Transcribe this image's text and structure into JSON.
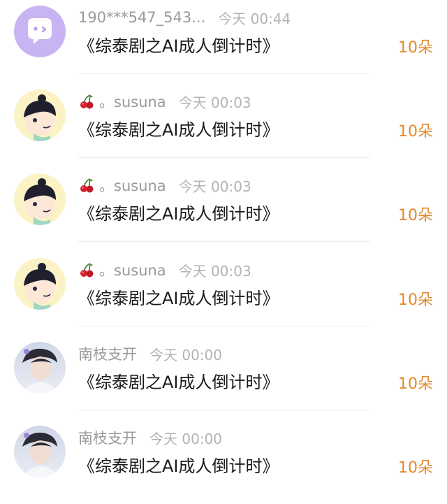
{
  "comments": [
    {
      "avatar": "speech-bubble-avatar",
      "prefix_icon": "",
      "username": "190***547_543...",
      "time": "今天 00:44",
      "title": "《综泰剧之AI成人倒计时》",
      "gift": "10朵"
    },
    {
      "avatar": "cartoon-boy-avatar",
      "prefix_icon": "cherry-icon",
      "username": "。susuna",
      "time": "今天 00:03",
      "title": "《综泰剧之AI成人倒计时》",
      "gift": "10朵"
    },
    {
      "avatar": "cartoon-boy-avatar",
      "prefix_icon": "cherry-icon",
      "username": "。susuna",
      "time": "今天 00:03",
      "title": "《综泰剧之AI成人倒计时》",
      "gift": "10朵"
    },
    {
      "avatar": "cartoon-boy-avatar",
      "prefix_icon": "cherry-icon",
      "username": "。susuna",
      "time": "今天 00:03",
      "title": "《综泰剧之AI成人倒计时》",
      "gift": "10朵"
    },
    {
      "avatar": "photo-person-avatar",
      "prefix_icon": "",
      "username": "南枝支开",
      "time": "今天 00:00",
      "title": "《综泰剧之AI成人倒计时》",
      "gift": "10朵"
    },
    {
      "avatar": "photo-person-avatar",
      "prefix_icon": "",
      "username": "南枝支开",
      "time": "今天 00:00",
      "title": "《综泰剧之AI成人倒计时》",
      "gift": "10朵"
    }
  ],
  "colors": {
    "username": "#9a9a9a",
    "time": "#b3b3b3",
    "title": "#1a1a1a",
    "gift": "#e08a2e",
    "divider": "#ececec",
    "bubble_avatar_bg": "#c9b4f3"
  }
}
